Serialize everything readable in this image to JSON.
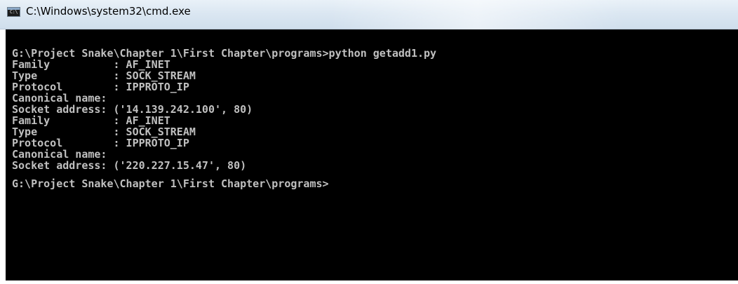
{
  "window": {
    "title": "C:\\Windows\\system32\\cmd.exe",
    "icon": "cmd-console-icon"
  },
  "console": {
    "lines": [
      "G:\\Project Snake\\Chapter 1\\First Chapter\\programs>python getadd1.py",
      "Family          : AF_INET",
      "Type            : SOCK_STREAM",
      "Protocol        : IPPROTO_IP",
      "Canonical name:",
      "Socket address: ('14.139.242.100', 80)",
      "Family          : AF_INET",
      "Type            : SOCK_STREAM",
      "Protocol        : IPPROTO_IP",
      "Canonical name:",
      "Socket address: ('220.227.15.47', 80)",
      "",
      "G:\\Project Snake\\Chapter 1\\First Chapter\\programs>"
    ]
  },
  "colors": {
    "console_background": "#000000",
    "console_text": "#c0c0c0",
    "titlebar": "#dbe7f2"
  }
}
